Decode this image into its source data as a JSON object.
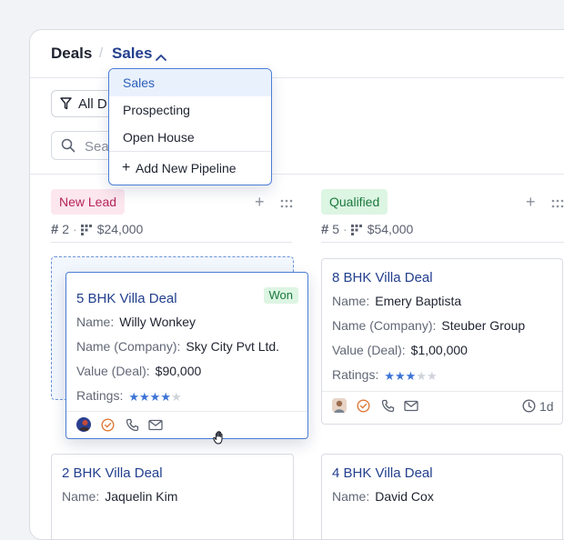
{
  "breadcrumb": {
    "root": "Deals",
    "separator": "/",
    "current": "Sales"
  },
  "toolbar": {
    "filter_label": "All D",
    "search_placeholder": "Sear"
  },
  "pipeline_dropdown": {
    "options": [
      "Sales",
      "Prospecting",
      "Open House"
    ],
    "selected": "Sales",
    "add_label": "Add New Pipeline"
  },
  "columns": [
    {
      "name": "New Lead",
      "count": "2",
      "total": "$24,000",
      "color": "#b5245a",
      "cards": [
        {
          "title": "2 BHK Villa Deal",
          "name_label": "Name:",
          "name": "Jaquelin Kim"
        }
      ]
    },
    {
      "name": "Qualified",
      "count": "5",
      "total": "$54,000",
      "color": "#1a7a3c",
      "cards": [
        {
          "title": "8 BHK Villa Deal",
          "name_label": "Name:",
          "name": "Emery Baptista",
          "company_label": "Name (Company):",
          "company": "Steuber Group",
          "value_label": "Value (Deal):",
          "value": "$1,00,000",
          "ratings_label": "Ratings:",
          "rating": 3,
          "rating_max": 5,
          "age": "1d"
        },
        {
          "title": "4 BHK Villa Deal",
          "name_label": "Name:",
          "name": "David Cox"
        }
      ]
    }
  ],
  "dragging_card": {
    "title": "5 BHK Villa Deal",
    "badge": "Won",
    "name_label": "Name:",
    "name": "Willy Wonkey",
    "company_label": "Name (Company):",
    "company": "Sky City Pvt Ltd.",
    "value_label": "Value (Deal):",
    "value": "$90,000",
    "ratings_label": "Ratings:",
    "rating": 4,
    "rating_max": 5
  },
  "colors": {
    "accent": "#23408e",
    "star": "#3d74d6",
    "won": "#1a7a3c"
  }
}
